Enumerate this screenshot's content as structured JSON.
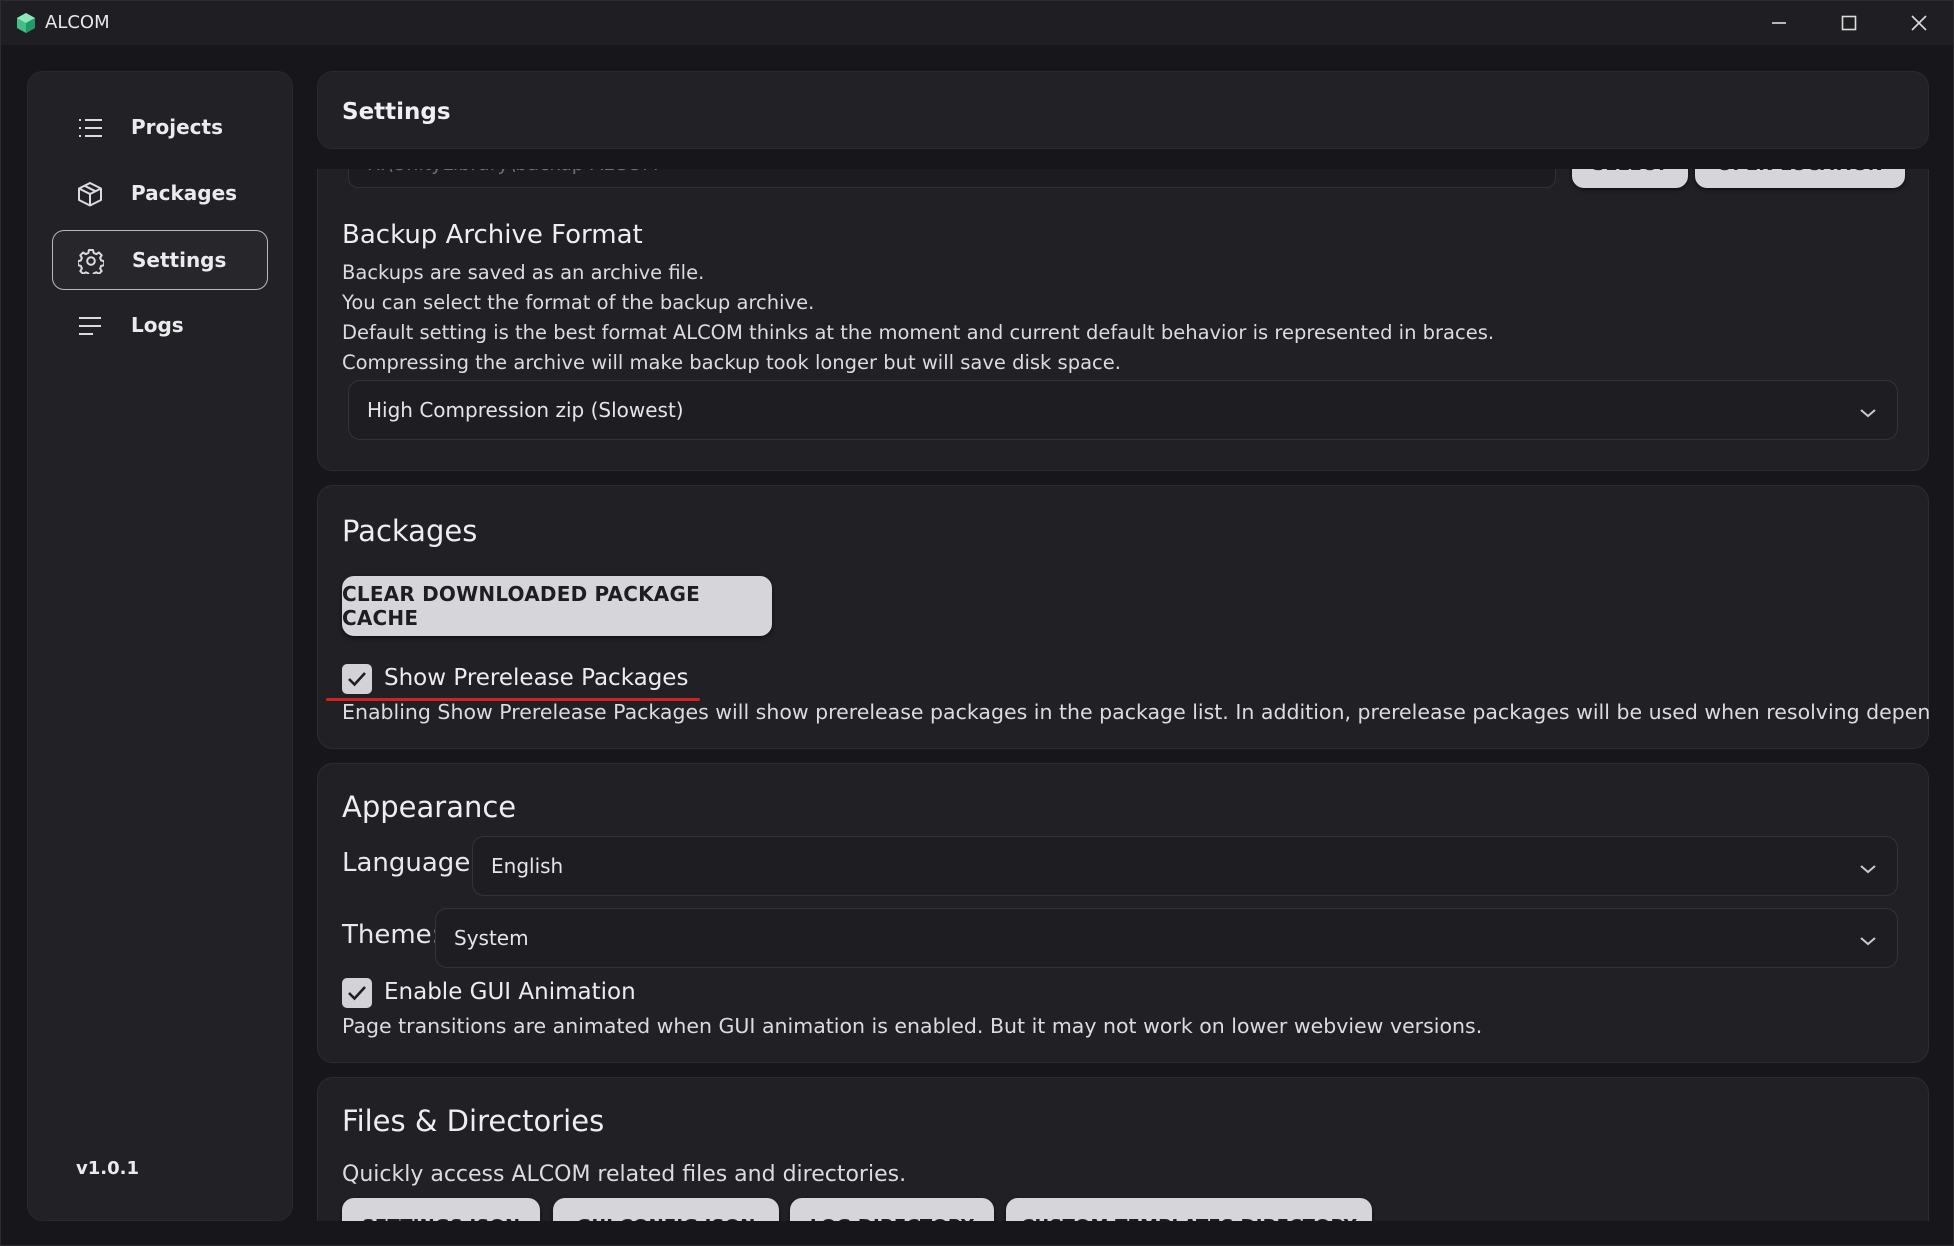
{
  "window": {
    "title": "ALCOM"
  },
  "sidebar": {
    "items": [
      {
        "label": "Projects",
        "icon": "list-icon"
      },
      {
        "label": "Packages",
        "icon": "package-icon"
      },
      {
        "label": "Settings",
        "icon": "gear-icon",
        "active": true
      },
      {
        "label": "Logs",
        "icon": "lines-icon"
      }
    ],
    "version": "v1.0.1"
  },
  "header": {
    "title": "Settings"
  },
  "backup": {
    "path_value": "R:\\UnityLibrary\\backup-ALCOM",
    "select_button": "SELECT",
    "open_location_button": "OPEN LOCATION",
    "format_title": "Backup Archive Format",
    "descriptions": [
      "Backups are saved as an archive file.",
      "You can select the format of the backup archive.",
      "Default setting is the best format ALCOM thinks at the moment and current default behavior is represented in braces.",
      "Compressing the archive will make backup took longer but will save disk space."
    ],
    "format_value": "High Compression zip (Slowest)"
  },
  "packages": {
    "title": "Packages",
    "clear_cache_button": "CLEAR DOWNLOADED PACKAGE CACHE",
    "prerelease_label": "Show Prerelease Packages",
    "prerelease_checked": true,
    "prerelease_description": "Enabling Show Prerelease Packages will show prerelease packages in the package list. In addition, prerelease packages will be used when resolving dependencies."
  },
  "appearance": {
    "title": "Appearance",
    "language_label": "Language:",
    "language_value": "English",
    "theme_label": "Theme:",
    "theme_value": "System",
    "animation_label": "Enable GUI Animation",
    "animation_checked": true,
    "animation_description": "Page transitions are animated when GUI animation is enabled. But it may not work on lower webview versions."
  },
  "files": {
    "title": "Files & Directories",
    "description": "Quickly access ALCOM related files and directories.",
    "buttons": [
      "SETTINGS JSON",
      "GUI CONFIG JSON",
      "LOG DIRECTORY",
      "CUSTOM TEMPLATES DIRECTORY"
    ]
  },
  "colors": {
    "window_bg": "#17171b",
    "card_bg": "#212125",
    "button_bg": "#d6d6da",
    "annotation": "#d42020"
  }
}
